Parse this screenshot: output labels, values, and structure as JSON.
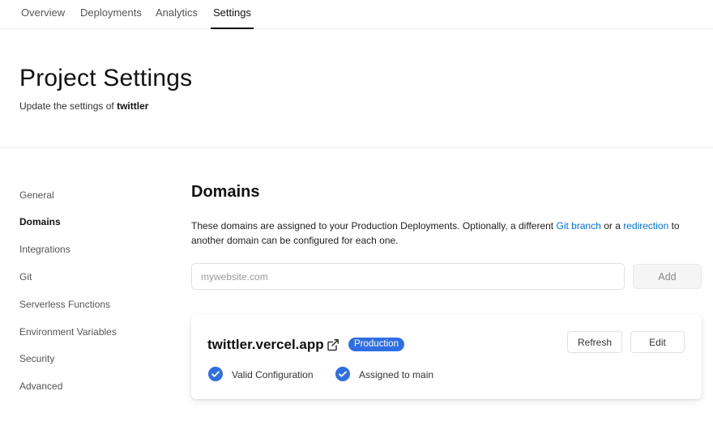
{
  "nav": {
    "tabs": [
      {
        "label": "Overview"
      },
      {
        "label": "Deployments"
      },
      {
        "label": "Analytics"
      },
      {
        "label": "Settings"
      }
    ]
  },
  "header": {
    "title": "Project Settings",
    "subtitle_prefix": "Update the settings of",
    "project_name": "twittler"
  },
  "sidebar": {
    "items": [
      {
        "label": "General"
      },
      {
        "label": "Domains"
      },
      {
        "label": "Integrations"
      },
      {
        "label": "Git"
      },
      {
        "label": "Serverless Functions"
      },
      {
        "label": "Environment Variables"
      },
      {
        "label": "Security"
      },
      {
        "label": "Advanced"
      }
    ]
  },
  "domains": {
    "title": "Domains",
    "desc_part1": "These domains are assigned to your Production Deployments. Optionally, a different",
    "git_branch_link": "Git branch",
    "desc_or": "or a",
    "redirection_link": "redirection",
    "desc_part2": "to another domain can be configured for each one.",
    "input_placeholder": "mywebsite.com",
    "add_label": "Add",
    "card": {
      "domain": "twittler.vercel.app",
      "badge": "Production",
      "refresh_label": "Refresh",
      "edit_label": "Edit",
      "status_config": "Valid Configuration",
      "status_assigned": "Assigned to main"
    }
  },
  "colors": {
    "accent": "#0070f3",
    "badge": "#2f6fe4",
    "check": "#2f6fe4"
  },
  "icons": {
    "external": "external-link-icon",
    "check": "check-circle-icon"
  }
}
